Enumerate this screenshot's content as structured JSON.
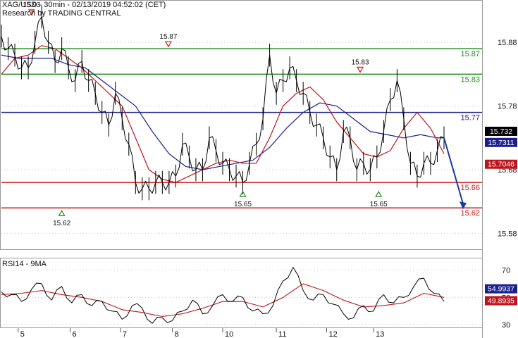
{
  "header": {
    "title": "XAG/USD - 30min - 02/13/2019 04:52:02 (CET)",
    "source": "Research by TRADING CENTRAL"
  },
  "colors": {
    "price": "#000000",
    "ma_fast": "#c0141c",
    "ma_slow": "#1a1f8c",
    "resistance": "#1e8c1e",
    "pivot": "#1a1f8c",
    "support": "#d01818",
    "target_arrow": "#1a3a9e",
    "last_price_badge": "#000000",
    "ma_slow_badge": "#1a1f8c",
    "ma_fast_badge": "#c0141c"
  },
  "chart_data": [
    {
      "type": "line",
      "title": "XAG/USD - 30min - 02/13/2019 04:52:02 (CET)",
      "x_ticks": [
        "5",
        "6",
        "7",
        "8",
        "10",
        "11",
        "12",
        "13"
      ],
      "y_ticks": [
        15.88,
        15.78,
        15.68,
        15.58
      ],
      "ylim": [
        15.555,
        15.92
      ],
      "series": [
        {
          "role": "price",
          "x": [
            0,
            0.2,
            0.4,
            0.6,
            0.8,
            1.0,
            1.2,
            1.4,
            1.6,
            1.8,
            2.0,
            2.2,
            2.4,
            2.6,
            2.8,
            3.0,
            3.2,
            3.4,
            3.6,
            3.8,
            4.0,
            4.2,
            4.4,
            4.6,
            4.8,
            5.0,
            5.2,
            5.4,
            5.6,
            5.8,
            6.0,
            6.2,
            6.4,
            6.6,
            6.8,
            7.0,
            7.2,
            7.4,
            7.6,
            7.8,
            8.0,
            8.2,
            8.4,
            8.6,
            8.8,
            9.0,
            9.2,
            9.4,
            9.6,
            9.8,
            10.0,
            10.2,
            10.4,
            10.6,
            10.8,
            11.0,
            11.2,
            11.4,
            11.6,
            11.8,
            12.0,
            12.2,
            12.4,
            12.6,
            12.8,
            13.0,
            13.2
          ],
          "values": [
            15.89,
            15.87,
            15.86,
            15.84,
            15.84,
            15.88,
            15.92,
            15.88,
            15.85,
            15.87,
            15.84,
            15.82,
            15.85,
            15.82,
            15.8,
            15.77,
            15.75,
            15.8,
            15.76,
            15.72,
            15.66,
            15.65,
            15.65,
            15.66,
            15.66,
            15.66,
            15.67,
            15.72,
            15.7,
            15.68,
            15.68,
            15.73,
            15.71,
            15.69,
            15.68,
            15.67,
            15.66,
            15.69,
            15.72,
            15.76,
            15.86,
            15.8,
            15.82,
            15.84,
            15.82,
            15.8,
            15.77,
            15.75,
            15.73,
            15.7,
            15.68,
            15.74,
            15.73,
            15.68,
            15.69,
            15.68,
            15.7,
            15.74,
            15.79,
            15.82,
            15.76,
            15.69,
            15.67,
            15.69,
            15.69,
            15.71,
            15.73
          ]
        },
        {
          "role": "moving-average-fast",
          "x": [
            0,
            0.4,
            0.8,
            1.2,
            1.6,
            2.0,
            2.4,
            2.8,
            3.2,
            3.6,
            4.0,
            4.4,
            4.8,
            5.2,
            5.6,
            6.0,
            6.4,
            6.8,
            7.2,
            7.6,
            8.0,
            8.4,
            8.8,
            9.2,
            9.6,
            10.0,
            10.4,
            10.8,
            11.2,
            11.6,
            12.0,
            12.4,
            12.8,
            13.2
          ],
          "values": [
            15.83,
            15.855,
            15.86,
            15.875,
            15.87,
            15.855,
            15.84,
            15.82,
            15.8,
            15.78,
            15.73,
            15.68,
            15.665,
            15.66,
            15.67,
            15.68,
            15.69,
            15.695,
            15.69,
            15.69,
            15.73,
            15.78,
            15.8,
            15.81,
            15.79,
            15.755,
            15.73,
            15.705,
            15.7,
            15.71,
            15.745,
            15.77,
            15.745,
            15.705
          ]
        },
        {
          "role": "moving-average-slow",
          "x": [
            0,
            0.5,
            1.0,
            1.5,
            2.0,
            2.5,
            3.0,
            3.5,
            4.0,
            4.5,
            5.0,
            5.5,
            6.0,
            6.5,
            7.0,
            7.5,
            8.0,
            8.5,
            9.0,
            9.5,
            10.0,
            10.5,
            11.0,
            11.5,
            12.0,
            12.5,
            13.0,
            13.2
          ],
          "values": [
            15.86,
            15.855,
            15.855,
            15.855,
            15.845,
            15.84,
            15.82,
            15.8,
            15.78,
            15.74,
            15.705,
            15.685,
            15.68,
            15.685,
            15.69,
            15.695,
            15.715,
            15.745,
            15.77,
            15.785,
            15.78,
            15.76,
            15.74,
            15.735,
            15.73,
            15.735,
            15.73,
            15.73
          ]
        }
      ],
      "levels": [
        {
          "role": "resistance",
          "value": 15.87,
          "label": "15.87"
        },
        {
          "role": "resistance",
          "value": 15.83,
          "label": "15.83"
        },
        {
          "role": "pivot",
          "value": 15.77,
          "label": "15.77"
        },
        {
          "role": "support",
          "value": 15.66,
          "label": "15.66"
        },
        {
          "role": "support",
          "value": 15.62,
          "label": "15.62"
        }
      ],
      "markers": [
        {
          "kind": "high",
          "x": 0.9,
          "value": 15.92,
          "label": "15.93"
        },
        {
          "kind": "high",
          "x": 4.98,
          "value": 15.87,
          "label": "15.87"
        },
        {
          "kind": "low",
          "x": 1.8,
          "value": 15.62,
          "label": "15.62"
        },
        {
          "kind": "low",
          "x": 7.2,
          "value": 15.65,
          "label": "15.65"
        },
        {
          "kind": "high",
          "x": 10.7,
          "value": 15.83,
          "label": "15.83"
        },
        {
          "kind": "low",
          "x": 11.25,
          "value": 15.65,
          "label": "15.65"
        }
      ],
      "price_tags": [
        {
          "role": "last-price",
          "value": 15.732,
          "label": "15.732"
        },
        {
          "role": "moving-average-slow",
          "value": 15.7311,
          "label": "15.7311"
        },
        {
          "role": "moving-average-fast",
          "value": 15.7046,
          "label": "15.7046"
        }
      ],
      "projection": {
        "from_value": 15.73,
        "to_value": 15.62
      }
    },
    {
      "type": "line",
      "title": "RSI14 - 9MA",
      "y_ticks": [
        70,
        50,
        30
      ],
      "ylim": [
        28,
        78
      ],
      "series": [
        {
          "role": "rsi",
          "x": [
            0,
            0.3,
            0.6,
            0.9,
            1.2,
            1.5,
            1.8,
            2.1,
            2.4,
            2.7,
            3.0,
            3.3,
            3.6,
            3.9,
            4.2,
            4.5,
            4.8,
            5.1,
            5.4,
            5.7,
            6.0,
            6.3,
            6.6,
            6.9,
            7.2,
            7.5,
            7.8,
            8.1,
            8.4,
            8.7,
            9.0,
            9.3,
            9.6,
            9.9,
            10.2,
            10.5,
            10.8,
            11.1,
            11.4,
            11.7,
            12.0,
            12.3,
            12.6,
            12.9,
            13.2
          ],
          "values": [
            54,
            52,
            47,
            56,
            60,
            48,
            58,
            46,
            52,
            44,
            47,
            40,
            34,
            44,
            42,
            31,
            35,
            33,
            40,
            48,
            38,
            44,
            52,
            47,
            50,
            40,
            38,
            44,
            62,
            72,
            55,
            48,
            52,
            45,
            38,
            35,
            44,
            40,
            52,
            46,
            50,
            58,
            64,
            53,
            47
          ]
        },
        {
          "role": "moving-average",
          "x": [
            0,
            0.6,
            1.2,
            1.8,
            2.4,
            3.0,
            3.6,
            4.2,
            4.8,
            5.4,
            6.0,
            6.6,
            7.2,
            7.8,
            8.4,
            9.0,
            9.6,
            10.2,
            10.8,
            11.4,
            12.0,
            12.6,
            13.2
          ],
          "values": [
            52,
            53,
            55,
            52,
            50,
            47,
            41,
            39,
            36,
            38,
            42,
            47,
            47,
            43,
            50,
            60,
            55,
            48,
            43,
            44,
            46,
            53,
            50
          ]
        }
      ],
      "price_tags": [
        {
          "role": "rsi",
          "value": 54.9937,
          "label": "54.9937"
        },
        {
          "role": "moving-average",
          "value": 49.8935,
          "label": "49.8935"
        }
      ]
    }
  ]
}
